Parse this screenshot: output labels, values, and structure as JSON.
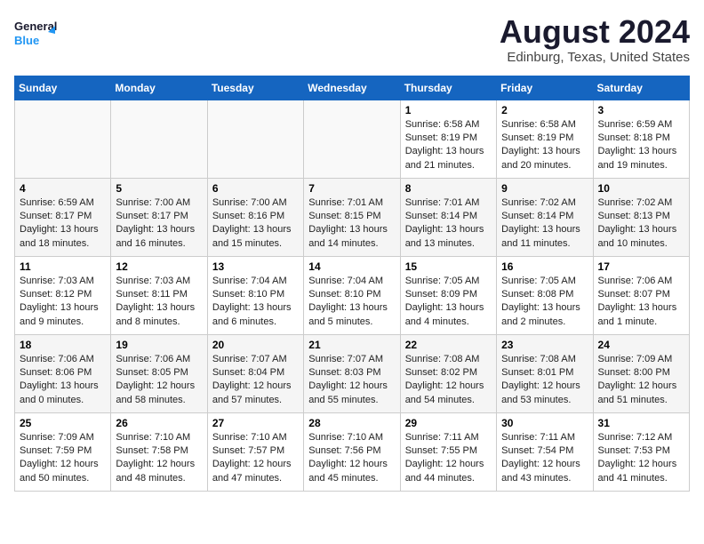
{
  "logo": {
    "line1": "General",
    "line2": "Blue"
  },
  "title": "August 2024",
  "subtitle": "Edinburg, Texas, United States",
  "days_of_week": [
    "Sunday",
    "Monday",
    "Tuesday",
    "Wednesday",
    "Thursday",
    "Friday",
    "Saturday"
  ],
  "weeks": [
    [
      {
        "day": "",
        "info": ""
      },
      {
        "day": "",
        "info": ""
      },
      {
        "day": "",
        "info": ""
      },
      {
        "day": "",
        "info": ""
      },
      {
        "day": "1",
        "info": "Sunrise: 6:58 AM\nSunset: 8:19 PM\nDaylight: 13 hours\nand 21 minutes."
      },
      {
        "day": "2",
        "info": "Sunrise: 6:58 AM\nSunset: 8:19 PM\nDaylight: 13 hours\nand 20 minutes."
      },
      {
        "day": "3",
        "info": "Sunrise: 6:59 AM\nSunset: 8:18 PM\nDaylight: 13 hours\nand 19 minutes."
      }
    ],
    [
      {
        "day": "4",
        "info": "Sunrise: 6:59 AM\nSunset: 8:17 PM\nDaylight: 13 hours\nand 18 minutes."
      },
      {
        "day": "5",
        "info": "Sunrise: 7:00 AM\nSunset: 8:17 PM\nDaylight: 13 hours\nand 16 minutes."
      },
      {
        "day": "6",
        "info": "Sunrise: 7:00 AM\nSunset: 8:16 PM\nDaylight: 13 hours\nand 15 minutes."
      },
      {
        "day": "7",
        "info": "Sunrise: 7:01 AM\nSunset: 8:15 PM\nDaylight: 13 hours\nand 14 minutes."
      },
      {
        "day": "8",
        "info": "Sunrise: 7:01 AM\nSunset: 8:14 PM\nDaylight: 13 hours\nand 13 minutes."
      },
      {
        "day": "9",
        "info": "Sunrise: 7:02 AM\nSunset: 8:14 PM\nDaylight: 13 hours\nand 11 minutes."
      },
      {
        "day": "10",
        "info": "Sunrise: 7:02 AM\nSunset: 8:13 PM\nDaylight: 13 hours\nand 10 minutes."
      }
    ],
    [
      {
        "day": "11",
        "info": "Sunrise: 7:03 AM\nSunset: 8:12 PM\nDaylight: 13 hours\nand 9 minutes."
      },
      {
        "day": "12",
        "info": "Sunrise: 7:03 AM\nSunset: 8:11 PM\nDaylight: 13 hours\nand 8 minutes."
      },
      {
        "day": "13",
        "info": "Sunrise: 7:04 AM\nSunset: 8:10 PM\nDaylight: 13 hours\nand 6 minutes."
      },
      {
        "day": "14",
        "info": "Sunrise: 7:04 AM\nSunset: 8:10 PM\nDaylight: 13 hours\nand 5 minutes."
      },
      {
        "day": "15",
        "info": "Sunrise: 7:05 AM\nSunset: 8:09 PM\nDaylight: 13 hours\nand 4 minutes."
      },
      {
        "day": "16",
        "info": "Sunrise: 7:05 AM\nSunset: 8:08 PM\nDaylight: 13 hours\nand 2 minutes."
      },
      {
        "day": "17",
        "info": "Sunrise: 7:06 AM\nSunset: 8:07 PM\nDaylight: 13 hours\nand 1 minute."
      }
    ],
    [
      {
        "day": "18",
        "info": "Sunrise: 7:06 AM\nSunset: 8:06 PM\nDaylight: 13 hours\nand 0 minutes."
      },
      {
        "day": "19",
        "info": "Sunrise: 7:06 AM\nSunset: 8:05 PM\nDaylight: 12 hours\nand 58 minutes."
      },
      {
        "day": "20",
        "info": "Sunrise: 7:07 AM\nSunset: 8:04 PM\nDaylight: 12 hours\nand 57 minutes."
      },
      {
        "day": "21",
        "info": "Sunrise: 7:07 AM\nSunset: 8:03 PM\nDaylight: 12 hours\nand 55 minutes."
      },
      {
        "day": "22",
        "info": "Sunrise: 7:08 AM\nSunset: 8:02 PM\nDaylight: 12 hours\nand 54 minutes."
      },
      {
        "day": "23",
        "info": "Sunrise: 7:08 AM\nSunset: 8:01 PM\nDaylight: 12 hours\nand 53 minutes."
      },
      {
        "day": "24",
        "info": "Sunrise: 7:09 AM\nSunset: 8:00 PM\nDaylight: 12 hours\nand 51 minutes."
      }
    ],
    [
      {
        "day": "25",
        "info": "Sunrise: 7:09 AM\nSunset: 7:59 PM\nDaylight: 12 hours\nand 50 minutes."
      },
      {
        "day": "26",
        "info": "Sunrise: 7:10 AM\nSunset: 7:58 PM\nDaylight: 12 hours\nand 48 minutes."
      },
      {
        "day": "27",
        "info": "Sunrise: 7:10 AM\nSunset: 7:57 PM\nDaylight: 12 hours\nand 47 minutes."
      },
      {
        "day": "28",
        "info": "Sunrise: 7:10 AM\nSunset: 7:56 PM\nDaylight: 12 hours\nand 45 minutes."
      },
      {
        "day": "29",
        "info": "Sunrise: 7:11 AM\nSunset: 7:55 PM\nDaylight: 12 hours\nand 44 minutes."
      },
      {
        "day": "30",
        "info": "Sunrise: 7:11 AM\nSunset: 7:54 PM\nDaylight: 12 hours\nand 43 minutes."
      },
      {
        "day": "31",
        "info": "Sunrise: 7:12 AM\nSunset: 7:53 PM\nDaylight: 12 hours\nand 41 minutes."
      }
    ]
  ]
}
